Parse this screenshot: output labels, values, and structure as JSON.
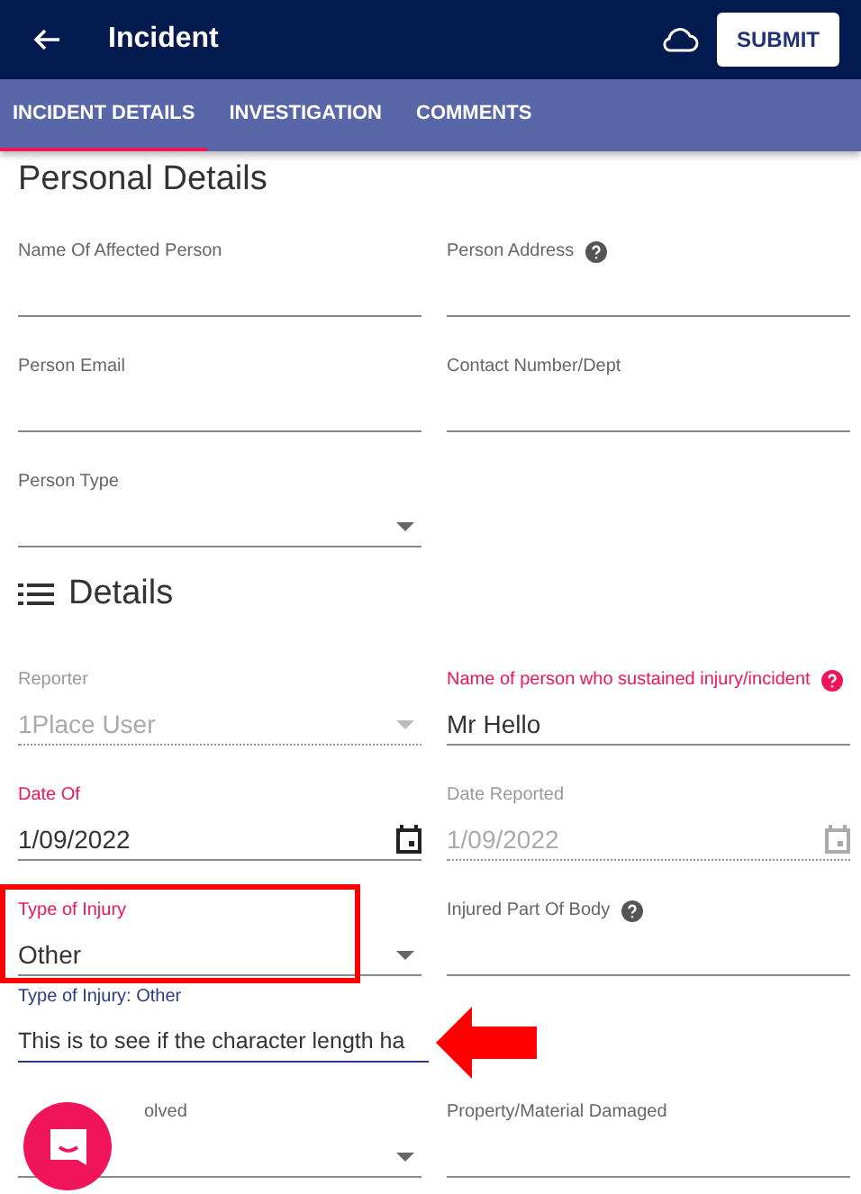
{
  "header": {
    "title": "Incident",
    "submit_label": "SUBMIT"
  },
  "tabs": [
    {
      "label": "INCIDENT DETAILS",
      "selected": true
    },
    {
      "label": "INVESTIGATION",
      "selected": false
    },
    {
      "label": "COMMENTS",
      "selected": false
    }
  ],
  "sections": [
    {
      "title": "Personal Details",
      "kind": "plain",
      "rows": [
        [
          {
            "label": "Name Of Affected Person",
            "kind": "text",
            "help": false,
            "required": false,
            "disabled": false,
            "focused": false
          },
          {
            "label": "Person Address",
            "kind": "text",
            "help": true,
            "required": false,
            "disabled": false,
            "focused": false
          }
        ],
        [
          {
            "label": "Person Email",
            "kind": "text",
            "help": false,
            "required": false,
            "disabled": false,
            "focused": false
          },
          {
            "label": "Contact Number/Dept",
            "kind": "text",
            "help": false,
            "required": false,
            "disabled": false,
            "focused": false
          }
        ],
        [
          {
            "label": "Person Type",
            "kind": "select",
            "help": false,
            "required": false,
            "disabled": false,
            "focused": false
          }
        ]
      ]
    },
    {
      "title": "Details",
      "kind": "list",
      "rows": [
        [
          {
            "label": "Reporter",
            "value": "1Place User",
            "kind": "select",
            "help": false,
            "required": false,
            "disabled": true,
            "focused": false
          },
          {
            "label": "Name of person who sustained injury/incident",
            "value": "Mr Hello",
            "kind": "text",
            "help": true,
            "required": true,
            "disabled": false,
            "focused": false
          }
        ],
        [
          {
            "label": "Date Of",
            "value": "1/09/2022",
            "kind": "date",
            "help": false,
            "required": true,
            "disabled": false,
            "focused": false
          },
          {
            "label": "Date Reported",
            "value": "1/09/2022",
            "kind": "date",
            "help": false,
            "required": false,
            "disabled": true,
            "focused": false
          }
        ],
        [
          {
            "label": "Type of Injury",
            "value": "Other",
            "kind": "select",
            "help": false,
            "required": true,
            "disabled": false,
            "focused": false,
            "highlighted": true
          },
          {
            "label": "Injured Part Of Body",
            "kind": "text",
            "help": true,
            "required": false,
            "disabled": false,
            "focused": false
          }
        ],
        [
          {
            "label": "Type of Injury: Other",
            "value": "This is to see if the character length ha",
            "kind": "text",
            "help": false,
            "required": false,
            "disabled": false,
            "focused": true,
            "pointed": true
          }
        ],
        [
          {
            "label": "olved",
            "covered": true,
            "kind": "select",
            "help": false,
            "required": false,
            "disabled": false,
            "focused": false
          },
          {
            "label": "Property/Material Damaged",
            "kind": "text",
            "help": false,
            "required": false,
            "disabled": false,
            "focused": false
          }
        ]
      ]
    }
  ]
}
